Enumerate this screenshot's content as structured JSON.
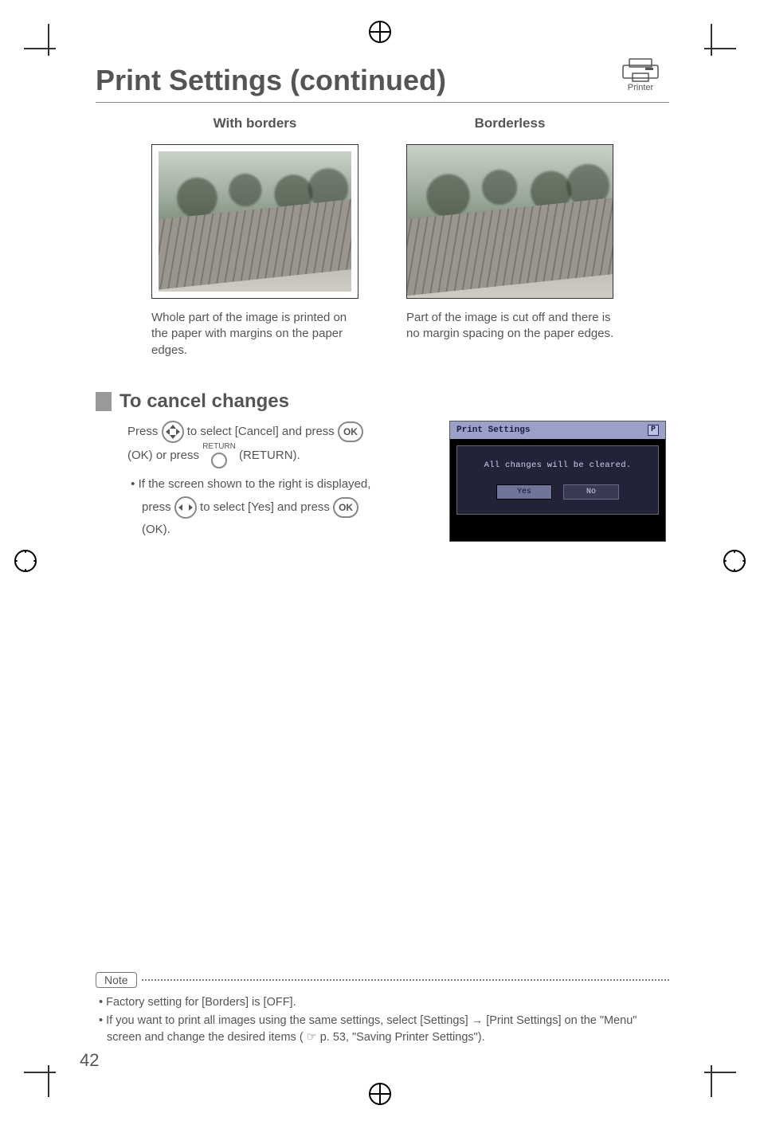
{
  "page_number": "42",
  "title": "Print Settings (continued)",
  "printer_label": "Printer",
  "columns": {
    "with_borders": {
      "heading": "With borders",
      "caption": "Whole part of the image is printed on the paper with margins on the paper edges."
    },
    "borderless": {
      "heading": "Borderless",
      "caption": "Part of the image is cut off and there is no margin spacing on the paper edges."
    }
  },
  "section": {
    "title": "To cancel changes",
    "line1_a": "Press ",
    "line1_b": " to select [Cancel] and press ",
    "line2_a": "(OK) or press ",
    "line2_b": " (RETURN).",
    "bullet_a": "If the screen shown to the right is displayed,",
    "bullet_b_a": "press ",
    "bullet_b_b": " to select [Yes] and press ",
    "bullet_c": "(OK).",
    "ok_label": "OK",
    "return_label": "RETURN"
  },
  "dialog": {
    "title": "Print Settings",
    "p_icon": "P",
    "message": "All changes will be cleared.",
    "yes": "Yes",
    "no": "No"
  },
  "note": {
    "label": "Note",
    "items": [
      "Factory setting for [Borders] is [OFF].",
      "If you want to print all images using the same settings, select [Settings] → [Print Settings] on the \"Menu\" screen and change the desired items ( ☞ p. 53, \"Saving Printer Settings\")."
    ]
  }
}
